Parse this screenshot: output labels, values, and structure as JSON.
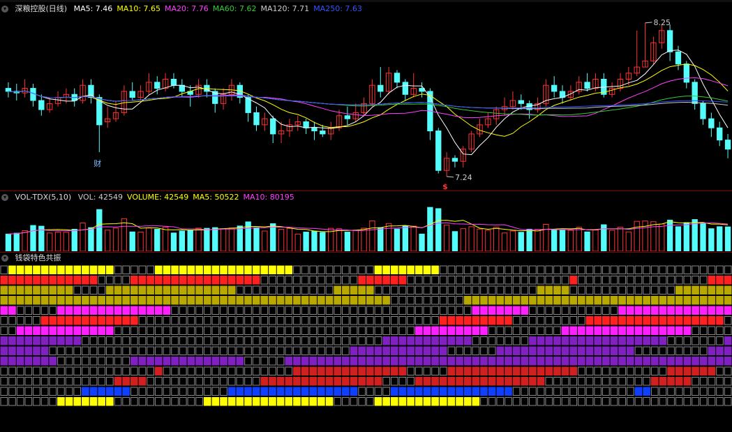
{
  "main_header": {
    "title": "深粮控股(日线)",
    "ma": [
      {
        "label": "MA5:",
        "value": "7.46",
        "color": "#ffffff"
      },
      {
        "label": "MA10:",
        "value": "7.65",
        "color": "#ffff00"
      },
      {
        "label": "MA20:",
        "value": "7.76",
        "color": "#ff40ff"
      },
      {
        "label": "MA60:",
        "value": "7.62",
        "color": "#33cc33"
      },
      {
        "label": "MA120:",
        "value": "7.71",
        "color": "#cccccc"
      },
      {
        "label": "MA250:",
        "value": "7.63",
        "color": "#3355ff"
      }
    ]
  },
  "annotations": {
    "high": "8.25",
    "low": "7.24",
    "cai": "财",
    "money_mark": "$"
  },
  "vol_header": {
    "name": "VOL-TDX(5,10)",
    "items": [
      {
        "label": "VOL:",
        "value": "42549",
        "color": "#cccccc"
      },
      {
        "label": "VOLUME:",
        "value": "42549",
        "color": "#ffff00"
      },
      {
        "label": "MA5:",
        "value": "50522",
        "color": "#ffff00"
      },
      {
        "label": "MA10:",
        "value": "80195",
        "color": "#ff40ff"
      }
    ]
  },
  "indicator_header": {
    "name": "钱袋特色共振"
  },
  "colors": {
    "up": "#ff3232",
    "down": "#54fcfc",
    "bg": "#000000",
    "separator": "#8b0000"
  },
  "chart_data": {
    "type": "candlestick",
    "price_range": [
      7.18,
      8.3
    ],
    "candles": [
      [
        7.82,
        7.8,
        7.86,
        7.76
      ],
      [
        7.8,
        7.79,
        7.85,
        7.74
      ],
      [
        7.79,
        7.82,
        7.88,
        7.76
      ],
      [
        7.82,
        7.74,
        7.85,
        7.7
      ],
      [
        7.74,
        7.68,
        7.78,
        7.64
      ],
      [
        7.68,
        7.72,
        7.76,
        7.66
      ],
      [
        7.72,
        7.76,
        7.8,
        7.7
      ],
      [
        7.76,
        7.78,
        7.82,
        7.72
      ],
      [
        7.78,
        7.74,
        7.82,
        7.7
      ],
      [
        7.74,
        7.84,
        7.88,
        7.72
      ],
      [
        7.84,
        7.76,
        7.88,
        7.72
      ],
      [
        7.76,
        7.58,
        7.78,
        7.4
      ],
      [
        7.6,
        7.62,
        7.7,
        7.56
      ],
      [
        7.62,
        7.66,
        7.74,
        7.6
      ],
      [
        7.66,
        7.8,
        7.84,
        7.64
      ],
      [
        7.8,
        7.76,
        7.86,
        7.74
      ],
      [
        7.76,
        7.8,
        7.84,
        7.74
      ],
      [
        7.8,
        7.86,
        7.92,
        7.78
      ],
      [
        7.86,
        7.82,
        7.9,
        7.78
      ],
      [
        7.82,
        7.88,
        7.92,
        7.8
      ],
      [
        7.88,
        7.84,
        7.92,
        7.82
      ],
      [
        7.84,
        7.8,
        7.88,
        7.76
      ],
      [
        7.8,
        7.78,
        7.84,
        7.7
      ],
      [
        7.78,
        7.84,
        7.88,
        7.76
      ],
      [
        7.84,
        7.8,
        7.88,
        7.76
      ],
      [
        7.8,
        7.72,
        7.82,
        7.66
      ],
      [
        7.72,
        7.78,
        7.82,
        7.68
      ],
      [
        7.78,
        7.84,
        7.88,
        7.74
      ],
      [
        7.84,
        7.76,
        7.86,
        7.72
      ],
      [
        7.76,
        7.66,
        7.78,
        7.6
      ],
      [
        7.66,
        7.58,
        7.7,
        7.54
      ],
      [
        7.58,
        7.62,
        7.66,
        7.54
      ],
      [
        7.62,
        7.52,
        7.64,
        7.46
      ],
      [
        7.52,
        7.54,
        7.6,
        7.46
      ],
      [
        7.54,
        7.58,
        7.62,
        7.5
      ],
      [
        7.58,
        7.6,
        7.64,
        7.54
      ],
      [
        7.6,
        7.56,
        7.62,
        7.52
      ],
      [
        7.56,
        7.54,
        7.6,
        7.48
      ],
      [
        7.54,
        7.52,
        7.58,
        7.5
      ],
      [
        7.52,
        7.56,
        7.6,
        7.48
      ],
      [
        7.56,
        7.64,
        7.68,
        7.54
      ],
      [
        7.64,
        7.62,
        7.7,
        7.58
      ],
      [
        7.62,
        7.66,
        7.72,
        7.6
      ],
      [
        7.66,
        7.72,
        7.76,
        7.64
      ],
      [
        7.72,
        7.84,
        7.88,
        7.7
      ],
      [
        7.84,
        7.8,
        7.96,
        7.76
      ],
      [
        7.8,
        7.92,
        7.96,
        7.78
      ],
      [
        7.92,
        7.86,
        7.94,
        7.82
      ],
      [
        7.86,
        7.78,
        7.88,
        7.74
      ],
      [
        7.78,
        7.82,
        7.92,
        7.76
      ],
      [
        7.82,
        7.8,
        7.86,
        7.76
      ],
      [
        7.8,
        7.54,
        7.82,
        7.48
      ],
      [
        7.54,
        7.28,
        7.56,
        7.26
      ],
      [
        7.28,
        7.36,
        7.4,
        7.24
      ],
      [
        7.36,
        7.34,
        7.38,
        7.3
      ],
      [
        7.34,
        7.42,
        7.44,
        7.3
      ],
      [
        7.42,
        7.52,
        7.54,
        7.4
      ],
      [
        7.52,
        7.58,
        7.62,
        7.5
      ],
      [
        7.58,
        7.62,
        7.66,
        7.56
      ],
      [
        7.62,
        7.68,
        7.7,
        7.58
      ],
      [
        7.68,
        7.7,
        7.76,
        7.64
      ],
      [
        7.7,
        7.74,
        7.8,
        7.68
      ],
      [
        7.74,
        7.72,
        7.78,
        7.68
      ],
      [
        7.72,
        7.68,
        7.74,
        7.62
      ],
      [
        7.68,
        7.72,
        7.76,
        7.66
      ],
      [
        7.72,
        7.84,
        7.88,
        7.7
      ],
      [
        7.84,
        7.8,
        7.9,
        7.76
      ],
      [
        7.8,
        7.76,
        7.84,
        7.72
      ],
      [
        7.76,
        7.8,
        7.84,
        7.74
      ],
      [
        7.8,
        7.86,
        7.9,
        7.78
      ],
      [
        7.86,
        7.82,
        7.92,
        7.8
      ],
      [
        7.82,
        7.88,
        7.92,
        7.8
      ],
      [
        7.88,
        7.78,
        7.92,
        7.76
      ],
      [
        7.78,
        7.82,
        7.86,
        7.76
      ],
      [
        7.82,
        7.88,
        7.92,
        7.8
      ],
      [
        7.88,
        7.92,
        7.96,
        7.84
      ],
      [
        7.92,
        7.96,
        8.2,
        7.9
      ],
      [
        7.96,
        8.0,
        8.25,
        7.96
      ],
      [
        8.0,
        8.12,
        8.16,
        7.98
      ],
      [
        8.12,
        8.2,
        8.24,
        8.08
      ],
      [
        8.2,
        8.06,
        8.24,
        8.0
      ],
      [
        8.06,
        7.98,
        8.1,
        7.94
      ],
      [
        7.98,
        7.86,
        8.0,
        7.82
      ],
      [
        7.86,
        7.72,
        7.88,
        7.68
      ],
      [
        7.72,
        7.62,
        7.74,
        7.58
      ],
      [
        7.62,
        7.56,
        7.66,
        7.5
      ],
      [
        7.56,
        7.48,
        7.6,
        7.44
      ],
      [
        7.48,
        7.42,
        7.52,
        7.36
      ]
    ]
  }
}
